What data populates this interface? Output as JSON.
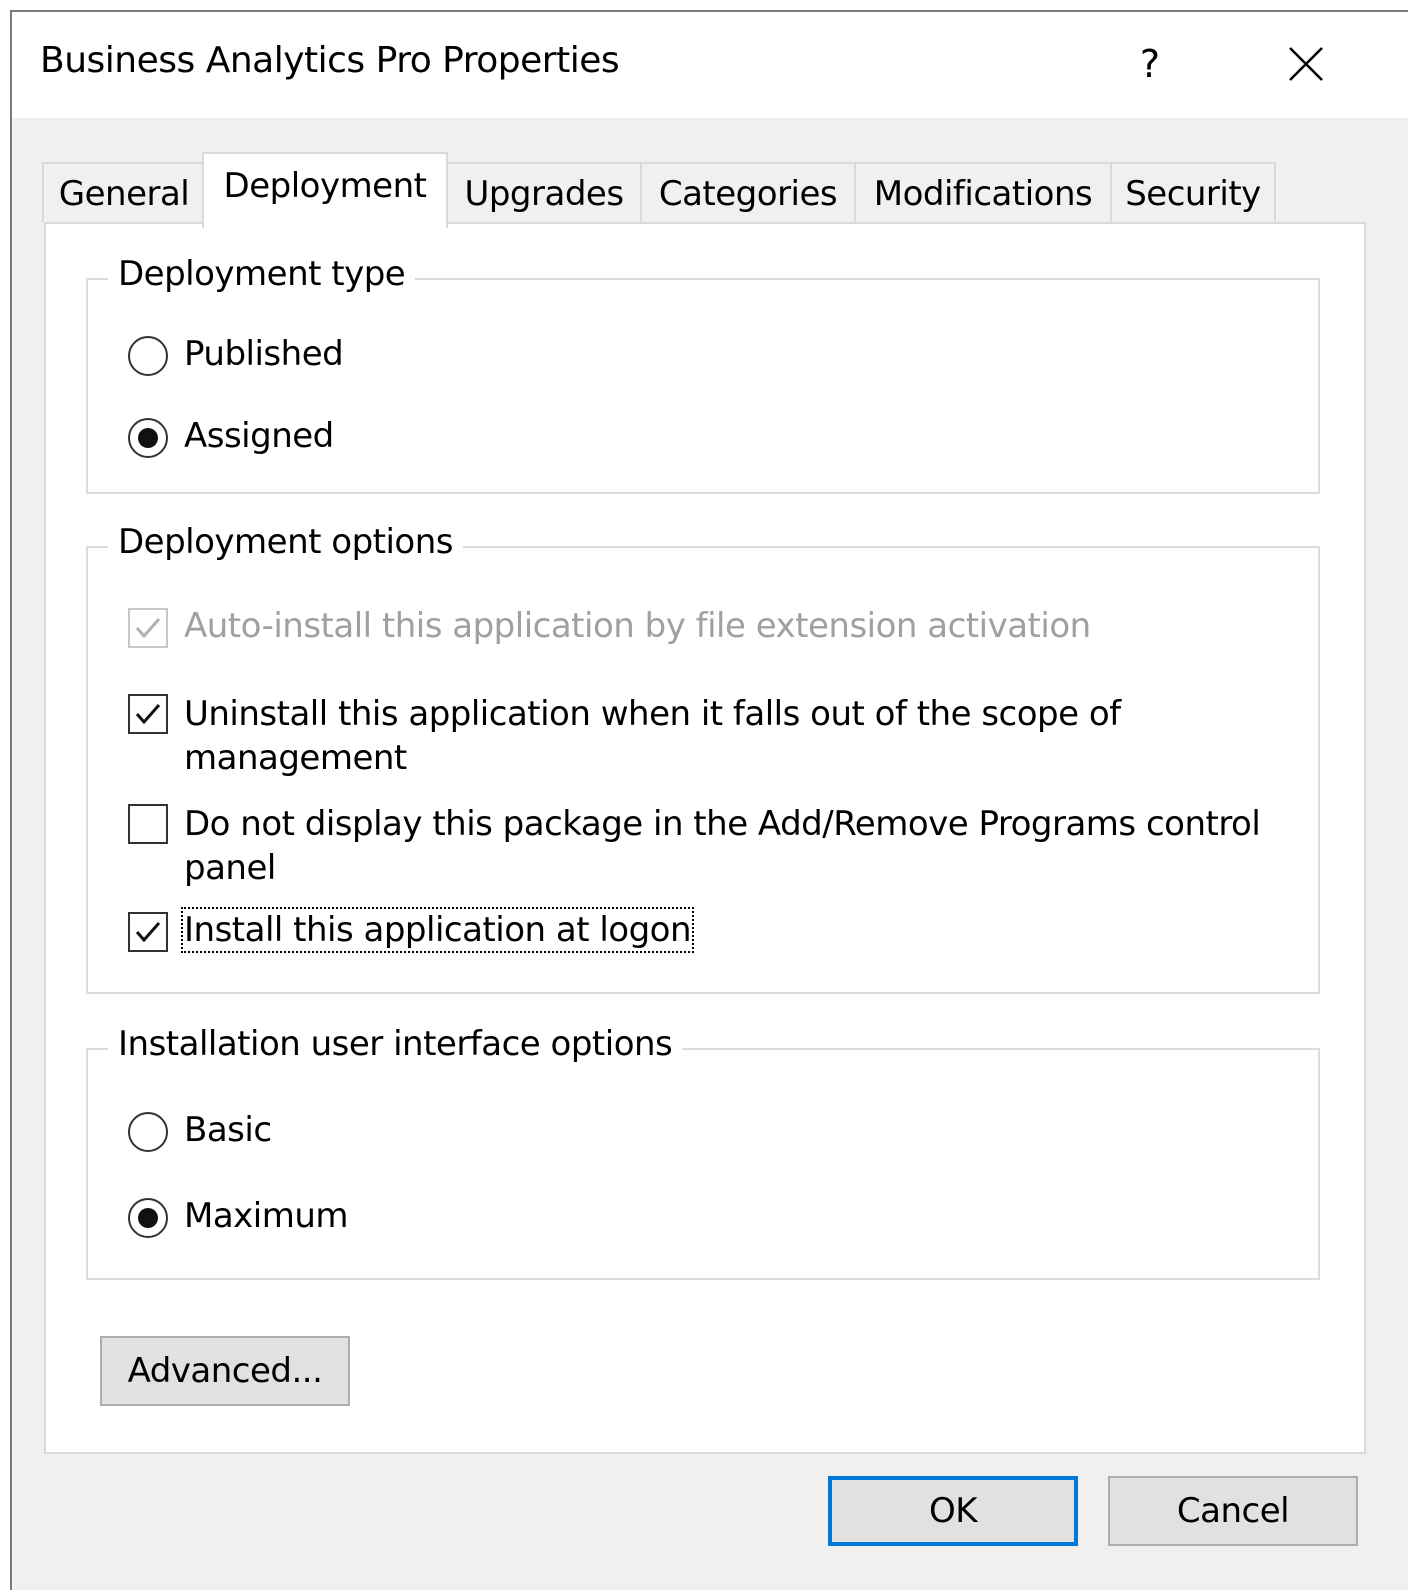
{
  "window": {
    "title": "Business Analytics Pro Properties",
    "help_label": "?"
  },
  "tabs": [
    {
      "label": "General",
      "active": false
    },
    {
      "label": "Deployment",
      "active": true
    },
    {
      "label": "Upgrades",
      "active": false
    },
    {
      "label": "Categories",
      "active": false
    },
    {
      "label": "Modifications",
      "active": false
    },
    {
      "label": "Security",
      "active": false
    }
  ],
  "deployment_type": {
    "legend": "Deployment type",
    "options": [
      {
        "label": "Published",
        "checked": false
      },
      {
        "label": "Assigned",
        "checked": true
      }
    ]
  },
  "deployment_options": {
    "legend": "Deployment options",
    "options": [
      {
        "label": "Auto-install this application by file extension activation",
        "checked": true,
        "disabled": true
      },
      {
        "label": "Uninstall this application when it falls out of the scope of management",
        "checked": true,
        "disabled": false
      },
      {
        "label": "Do not display this package in the Add/Remove Programs control panel",
        "checked": false,
        "disabled": false
      },
      {
        "label": "Install this application at logon",
        "checked": true,
        "disabled": false,
        "focused": true
      }
    ]
  },
  "ui_options": {
    "legend": "Installation user interface options",
    "options": [
      {
        "label": "Basic",
        "checked": false
      },
      {
        "label": "Maximum",
        "checked": true
      }
    ]
  },
  "buttons": {
    "advanced": "Advanced...",
    "ok": "OK",
    "cancel": "Cancel"
  },
  "colors": {
    "dialog_bg": "#f0f0f0",
    "default_button_border": "#0078d7"
  }
}
